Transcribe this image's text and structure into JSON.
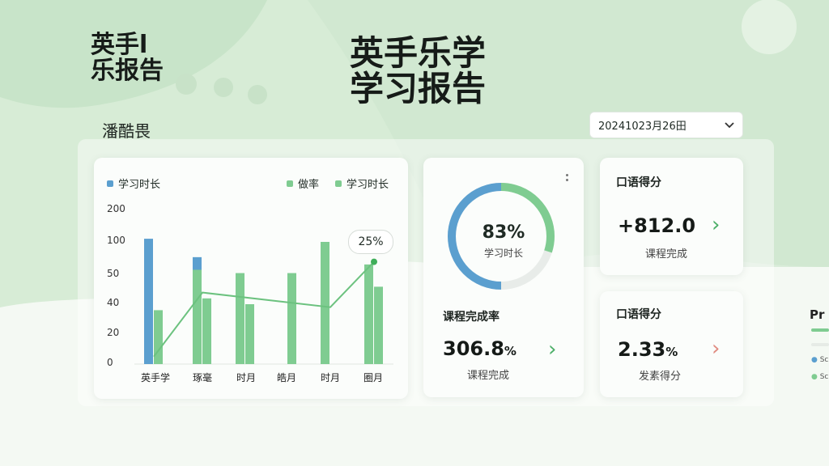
{
  "brand": {
    "line1": "英手l",
    "line2": "乐报告"
  },
  "hero": {
    "line1": "英手乐学",
    "line2": "学习报告"
  },
  "subtitle": "潘酷畏",
  "date_select": {
    "value": "20241023月26田"
  },
  "colors": {
    "blue": "#5b9fcf",
    "green": "#7fcc91",
    "accent_red": "#e08b80",
    "bg_green": "#cfe6cf"
  },
  "chart_data": {
    "type": "bar",
    "legend": [
      "学习时长",
      "做率",
      "学习时长"
    ],
    "categories": [
      "英手学",
      "琢毫",
      "时月",
      "皓月",
      "时月",
      "圈月"
    ],
    "yticks": [
      "0",
      "20",
      "40",
      "50",
      "100",
      "200"
    ],
    "series": [
      {
        "name": "学习时长",
        "values": [
          110,
          77,
          0,
          0,
          59,
          0
        ]
      },
      {
        "name": "做率",
        "values": [
          36,
          0,
          0,
          0,
          0,
          0
        ]
      },
      {
        "name": "学习时长",
        "values": [
          0,
          58,
          53,
          0,
          100,
          66
        ]
      },
      {
        "name": "做率",
        "values": [
          0,
          42,
          40,
          53,
          0,
          46
        ]
      }
    ],
    "trend": [
      5,
      44,
      0,
      0,
      38,
      70
    ],
    "callout": "25%"
  },
  "ring_card": {
    "percent_label": "83%",
    "label": "学习时长",
    "progress": 0.8,
    "stat_title": "课程完成率",
    "stat_value": "306.8",
    "stat_unit": "%",
    "stat_sub": "课程完成"
  },
  "stat1": {
    "title": "口语得分",
    "value": "+812.0",
    "sub": "课程完成"
  },
  "stat2": {
    "title": "口语得分",
    "value": "2.33",
    "unit": "%",
    "sub": "发素得分"
  },
  "edge": {
    "text": "Pr",
    "item1": "Sc",
    "item2": "Sc"
  }
}
